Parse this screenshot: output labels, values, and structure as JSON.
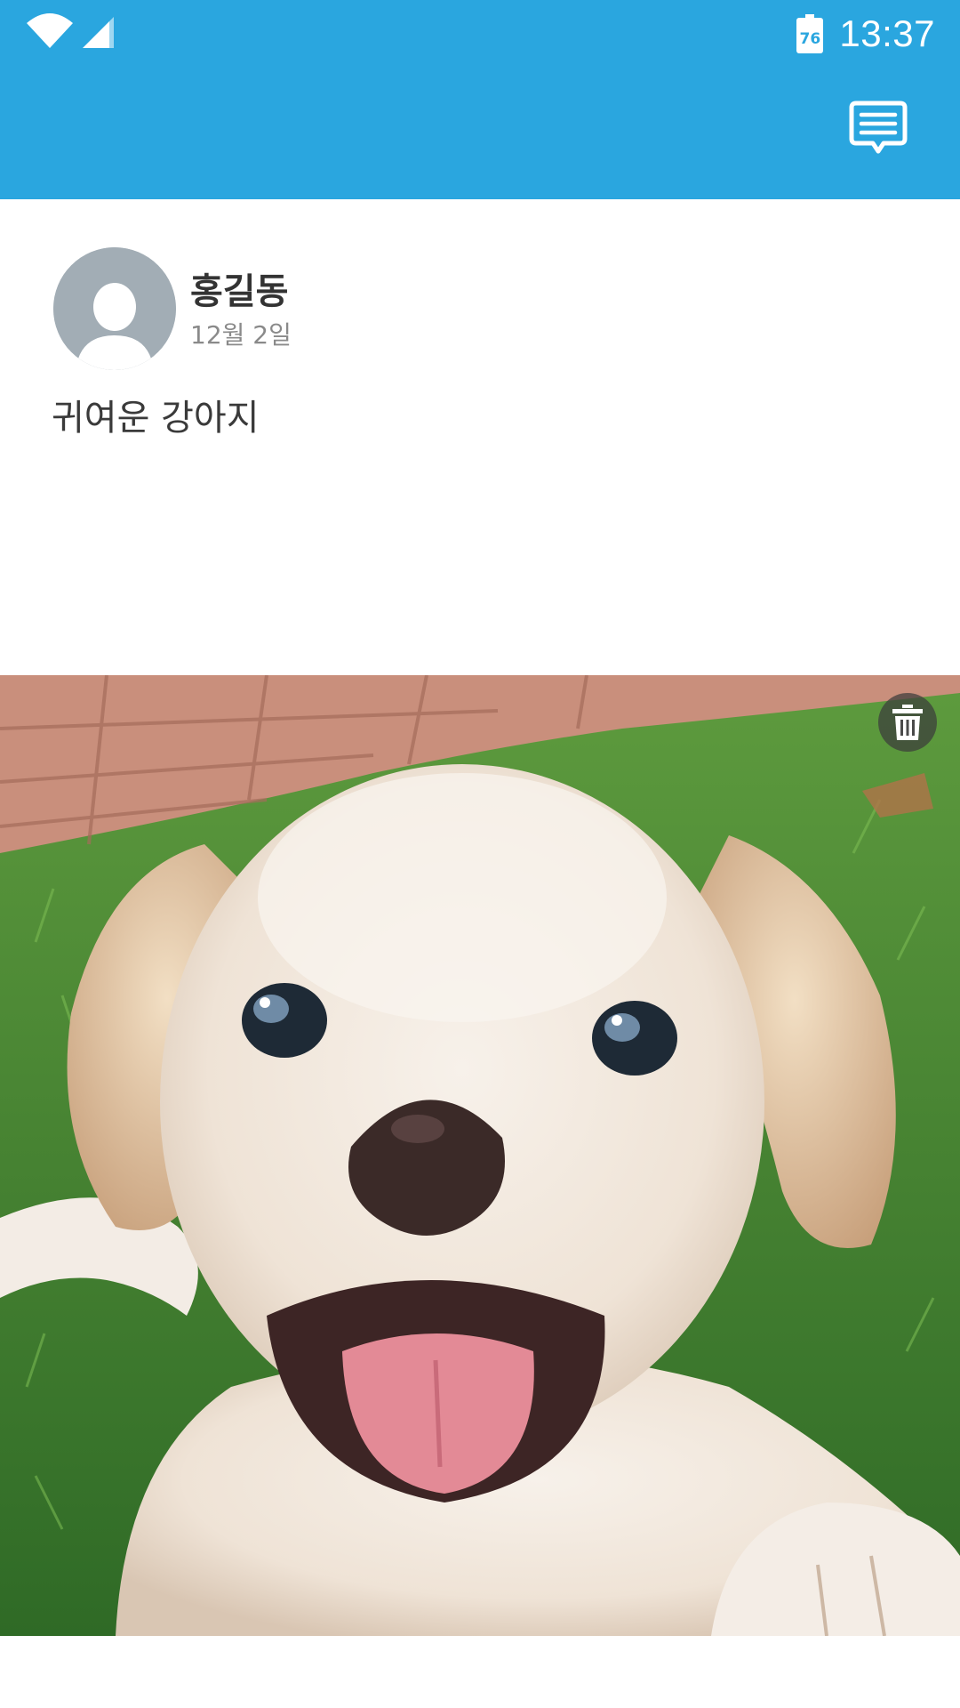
{
  "status_bar": {
    "battery_level": "76",
    "time": "13:37",
    "icons": [
      "wifi-icon",
      "cellular-signal-icon",
      "battery-icon"
    ]
  },
  "app_bar": {
    "color": "#2aa6df",
    "actions": [
      {
        "icon": "chat-icon"
      }
    ]
  },
  "post": {
    "author": {
      "name": "홍길동",
      "avatar_icon": "default-avatar-icon"
    },
    "date": "12월 2일",
    "text": "귀여운 강아지",
    "photo": {
      "subject": "puppy-photo",
      "action_icon": "trash-icon"
    }
  }
}
